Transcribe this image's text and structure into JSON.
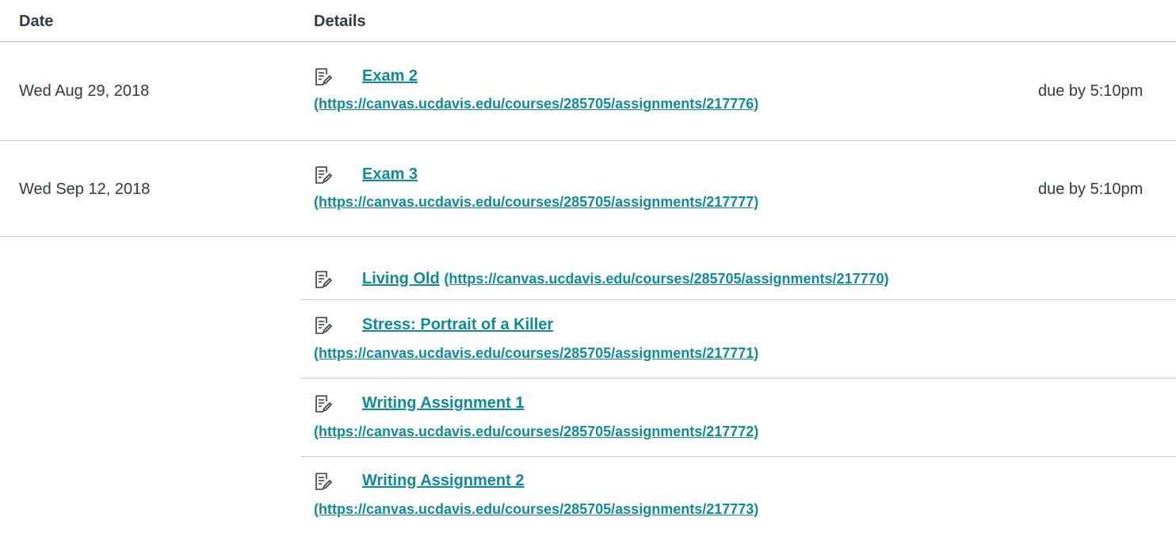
{
  "table": {
    "headers": {
      "date": "Date",
      "details": "Details"
    },
    "rows": [
      {
        "date": "Wed Aug 29, 2018",
        "title": "Exam 2",
        "url": "(https://canvas.ucdavis.edu/courses/285705/assignments/217776)",
        "due": "due by 5:10pm"
      },
      {
        "date": "Wed Sep 12, 2018",
        "title": "Exam 3",
        "url": "(https://canvas.ucdavis.edu/courses/285705/assignments/217777)",
        "due": "due by 5:10pm"
      }
    ],
    "undated": [
      {
        "title": "Living Old",
        "url": "(https://canvas.ucdavis.edu/courses/285705/assignments/217770)"
      },
      {
        "title": "Stress: Portrait of a Killer",
        "url": "(https://canvas.ucdavis.edu/courses/285705/assignments/217771)"
      },
      {
        "title": "Writing Assignment 1",
        "url": "(https://canvas.ucdavis.edu/courses/285705/assignments/217772)"
      },
      {
        "title": "Writing Assignment 2",
        "url": "(https://canvas.ucdavis.edu/courses/285705/assignments/217773)"
      }
    ]
  },
  "icons": {
    "assignment": "assignment-icon"
  },
  "colors": {
    "link": "#0e8a9a",
    "text": "#2d3b45",
    "divider": "#c7cdd1"
  }
}
